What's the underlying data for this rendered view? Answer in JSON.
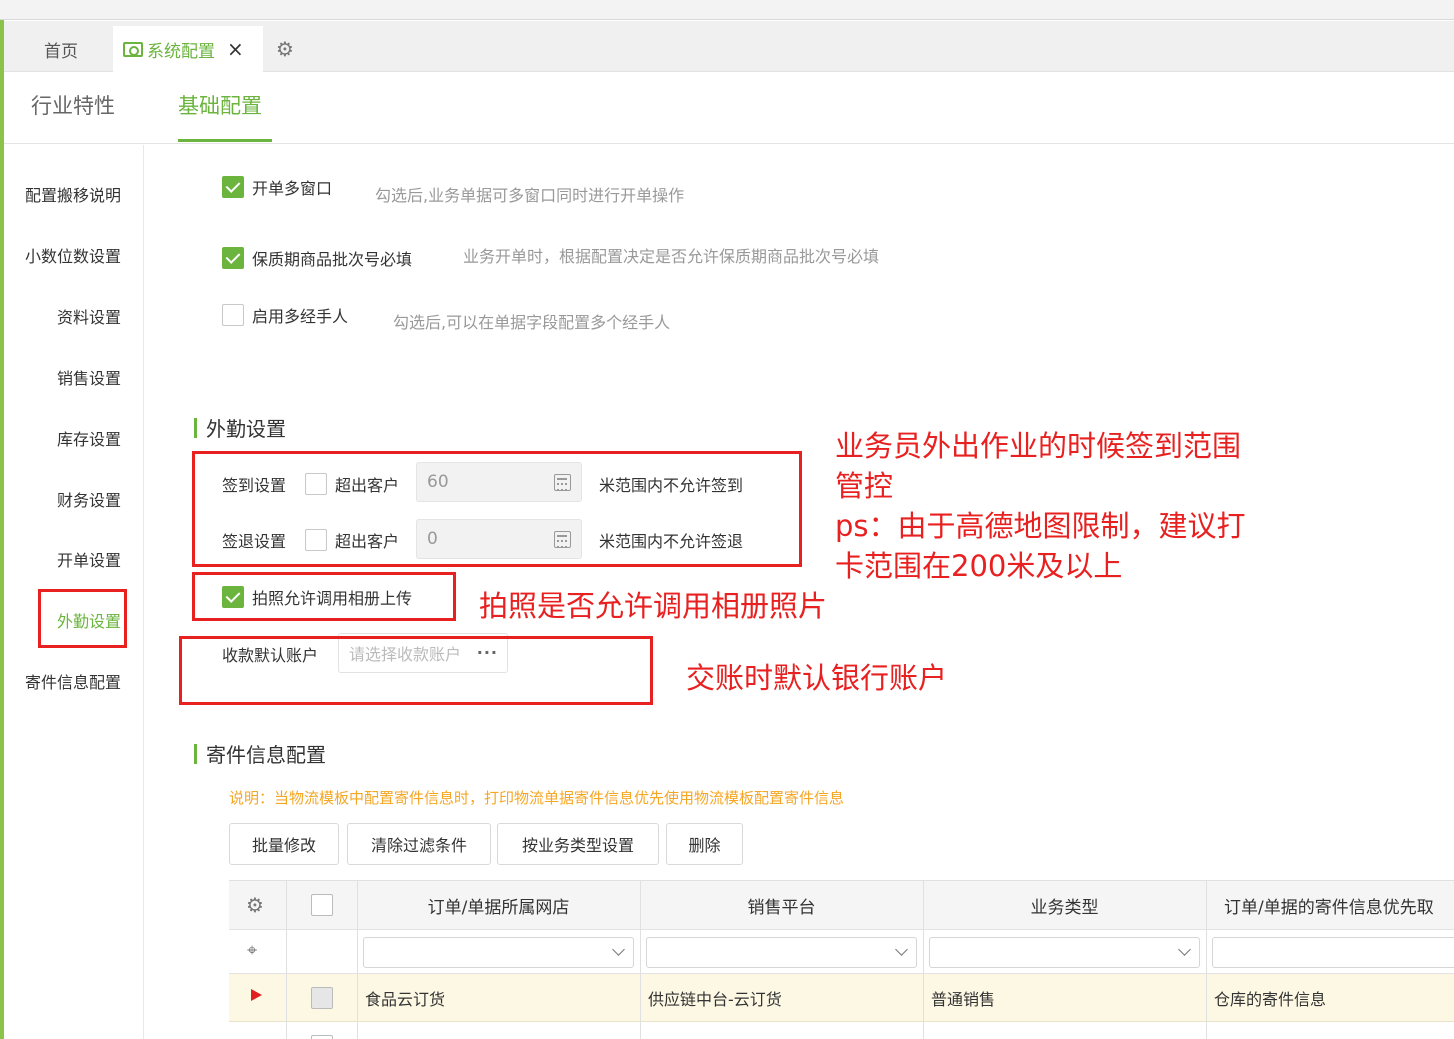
{
  "tabs": {
    "home": "首页",
    "config": "系统配置",
    "close": "×"
  },
  "subtabs": [
    "行业特性",
    "基础配置"
  ],
  "sidebar": [
    "配置搬移说明",
    "小数位数设置",
    "资料设置",
    "销售设置",
    "库存设置",
    "财务设置",
    "开单设置",
    "外勤设置",
    "寄件信息配置"
  ],
  "options": [
    {
      "label": "开单多窗口",
      "checked": true,
      "desc": "勾选后,业务单据可多窗口同时进行开单操作"
    },
    {
      "label": "保质期商品批次号必填",
      "checked": true,
      "desc": "业务开单时，根据配置决定是否允许保质期商品批次号必填"
    },
    {
      "label": "启用多经手人",
      "checked": false,
      "desc": "勾选后,可以在单据字段配置多个经手人"
    }
  ],
  "field": {
    "title": "外勤设置",
    "checkin_label": "签到设置",
    "checkin_option": "超出客户",
    "checkin_value": "60",
    "checkin_suffix": "米范围内不允许签到",
    "checkout_label": "签退设置",
    "checkout_option": "超出客户",
    "checkout_value": "0",
    "checkout_suffix": "米范围内不允许签退",
    "photo_label": "拍照允许调用相册上传",
    "account_label": "收款默认账户",
    "account_placeholder": "请选择收款账户",
    "account_dots": "···"
  },
  "annotations": {
    "range_line1": "业务员外出作业的时候签到范围",
    "range_line2": "管控",
    "range_line3": "ps：由于高德地图限制，建议打",
    "range_line4": "卡范围在200米及以上",
    "photo": "拍照是否允许调用相册照片",
    "account": "交账时默认银行账户"
  },
  "shipping": {
    "title": "寄件信息配置",
    "note": "说明：当物流模板中配置寄件信息时，打印物流单据寄件信息优先使用物流模板配置寄件信息",
    "buttons": [
      "批量修改",
      "清除过滤条件",
      "按业务类型设置",
      "删除"
    ],
    "columns": [
      "订单/单据所属网店",
      "销售平台",
      "业务类型",
      "订单/单据的寄件信息优先取"
    ],
    "rows": [
      [
        "食品云订货",
        "供应链中台-云订货",
        "普通销售",
        "仓库的寄件信息"
      ]
    ]
  },
  "colors": {
    "accent": "#6bb43e",
    "annotation": "#e82020",
    "note": "#f5a623"
  }
}
